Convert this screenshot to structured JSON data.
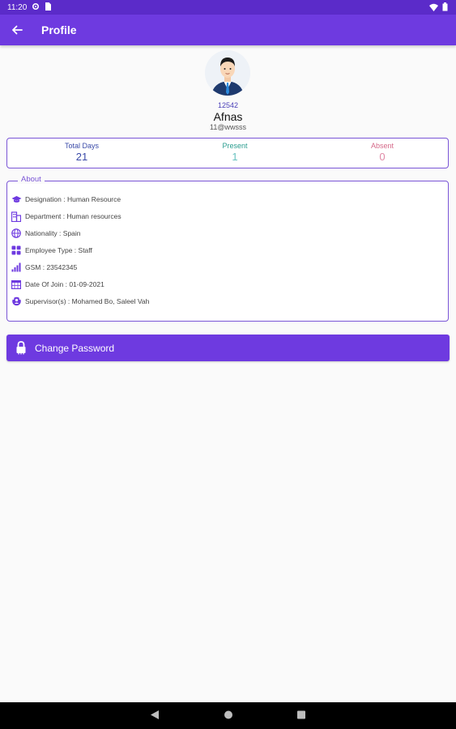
{
  "status_bar": {
    "time": "11:20"
  },
  "app_bar": {
    "title": "Profile"
  },
  "profile": {
    "employee_id": "12542",
    "name": "Afnas",
    "email": "11@wwsss"
  },
  "stats": {
    "total_days": {
      "label": "Total Days",
      "value": "21"
    },
    "present": {
      "label": "Present",
      "value": "1"
    },
    "absent": {
      "label": "Absent",
      "value": "0"
    }
  },
  "about": {
    "title": "About",
    "rows": [
      {
        "icon": "graduation-cap-icon",
        "text": "Designation : Human Resource"
      },
      {
        "icon": "building-icon",
        "text": "Department : Human resources"
      },
      {
        "icon": "globe-icon",
        "text": "Nationality : Spain"
      },
      {
        "icon": "grid-icon",
        "text": "Employee Type : Staff"
      },
      {
        "icon": "signal-icon",
        "text": "GSM : 23542345"
      },
      {
        "icon": "calendar-icon",
        "text": "Date Of Join : 01-09-2021"
      },
      {
        "icon": "supervisor-icon",
        "text": "Supervisor(s) : Mohamed Bo, Saleel Vah"
      }
    ]
  },
  "actions": {
    "change_password": "Change Password"
  },
  "colors": {
    "primary": "#6e3ae0",
    "status_bar": "#5b2bc9",
    "border": "#7a55d6"
  }
}
